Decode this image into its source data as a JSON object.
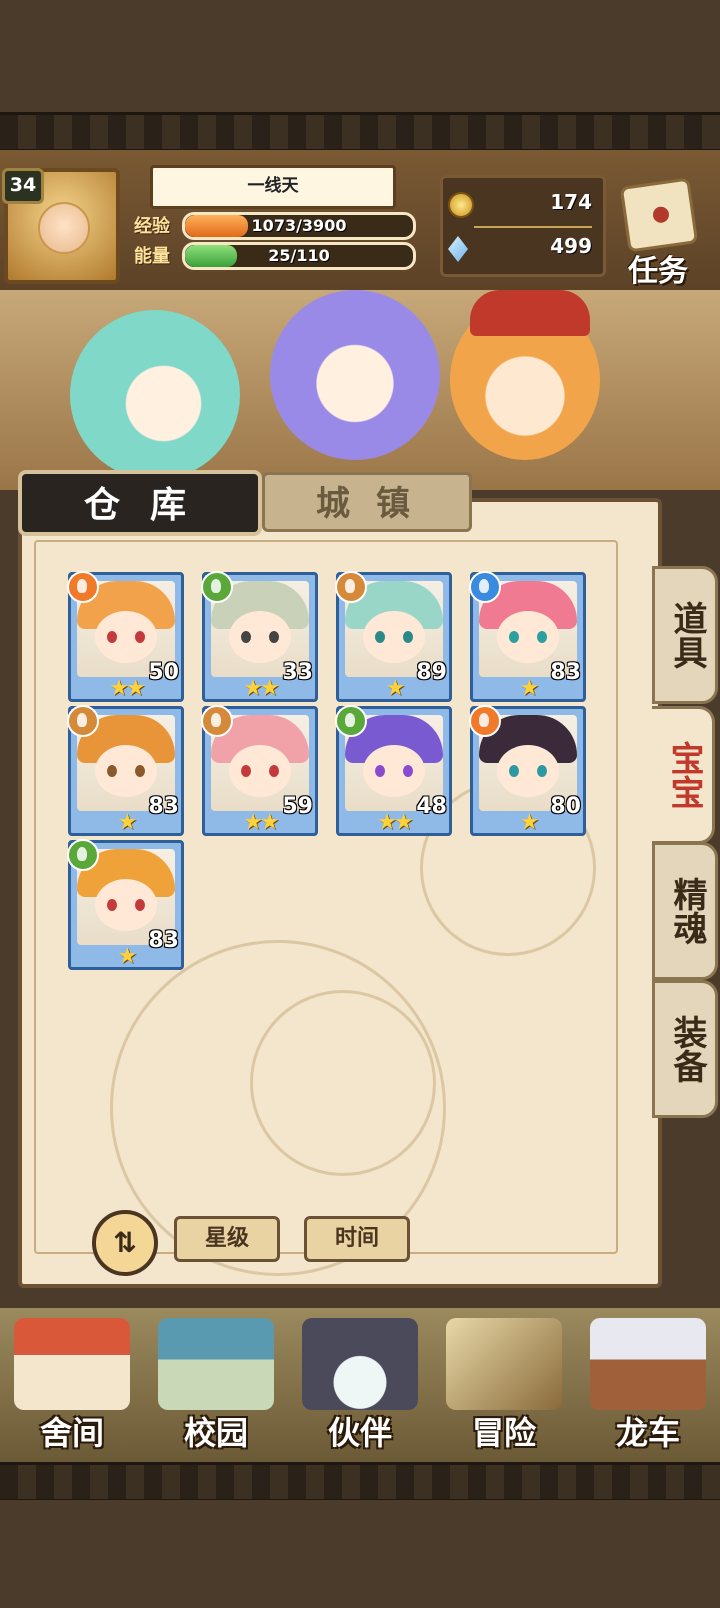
{
  "player": {
    "level": "34",
    "name": "一线天",
    "exp_label": "经验",
    "exp_value": "1073/3900",
    "exp_progress": 0.275,
    "energy_label": "能量",
    "energy_value": "25/110",
    "energy_progress": 0.227
  },
  "currency": {
    "coins": "174",
    "gems": "499"
  },
  "quest": {
    "label": "任务"
  },
  "tabs": {
    "warehouse": "仓库",
    "town": "城镇"
  },
  "side_tabs": [
    "道具",
    "宝宝",
    "精魂",
    "装备"
  ],
  "pets": [
    {
      "level": "50",
      "stars": "★★",
      "element": "fire",
      "element_color": "#f07a2a",
      "hair": "#f2a24a",
      "eye": "#c43a3a"
    },
    {
      "level": "33",
      "stars": "★★",
      "element": "leaf",
      "element_color": "#5aa83a",
      "hair": "#c9d2b8",
      "eye": "#444444"
    },
    {
      "level": "89",
      "stars": "★",
      "element": "earth",
      "element_color": "#d58a3a",
      "hair": "#9ad6c8",
      "eye": "#2a8a8a"
    },
    {
      "level": "83",
      "stars": "★",
      "element": "water",
      "element_color": "#3a8ae0",
      "hair": "#ef7a92",
      "eye": "#2aa0a0"
    },
    {
      "level": "83",
      "stars": "★",
      "element": "earth",
      "element_color": "#d58a3a",
      "hair": "#e8953a",
      "eye": "#8a5a2a"
    },
    {
      "level": "59",
      "stars": "★★",
      "element": "earth",
      "element_color": "#d58a3a",
      "hair": "#f0a2a8",
      "eye": "#c43a3a"
    },
    {
      "level": "48",
      "stars": "★★",
      "element": "leaf",
      "element_color": "#5aa83a",
      "hair": "#7a5ad0",
      "eye": "#8a4ad0"
    },
    {
      "level": "80",
      "stars": "★",
      "element": "fire",
      "element_color": "#f07a2a",
      "hair": "#3a2a3a",
      "eye": "#2a9aa0"
    },
    {
      "level": "83",
      "stars": "★",
      "element": "leaf",
      "element_color": "#5aa83a",
      "hair": "#f0a23a",
      "eye": "#c43a3a"
    }
  ],
  "sort": {
    "toggle_icon": "⇅",
    "star_label": "星级",
    "time_label": "时间"
  },
  "nav": [
    "舍间",
    "校园",
    "伙伴",
    "冒险",
    "龙车"
  ]
}
